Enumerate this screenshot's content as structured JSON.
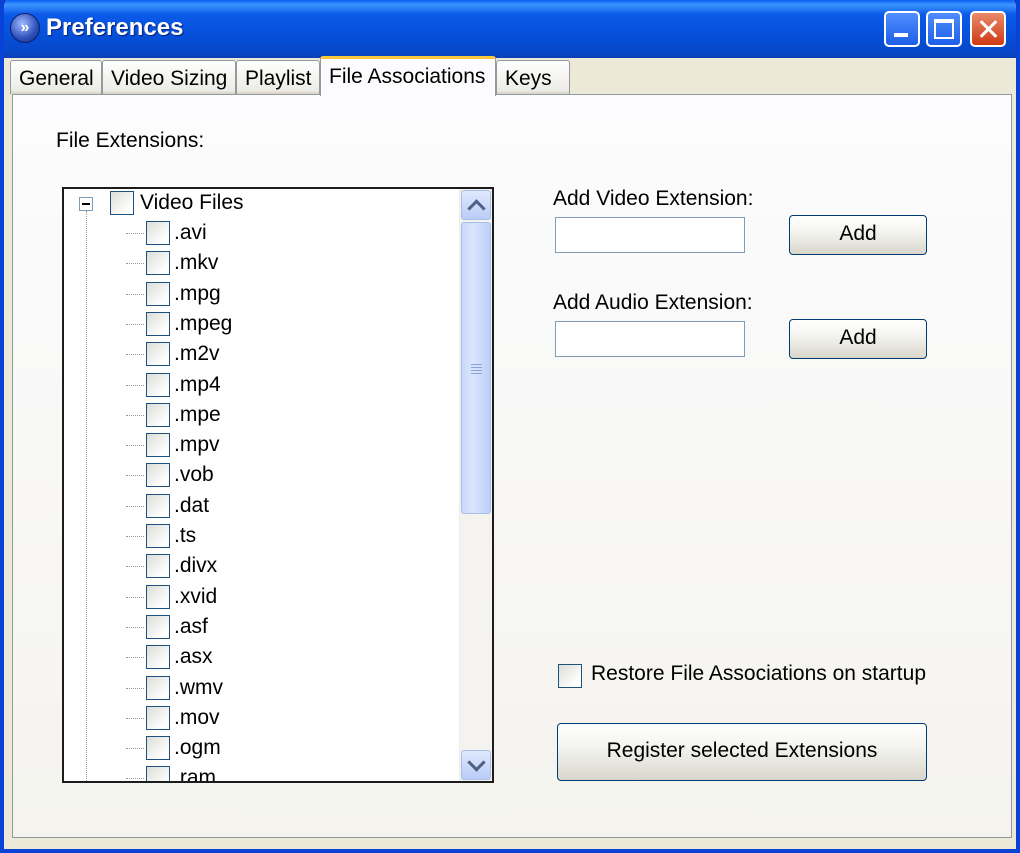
{
  "window": {
    "title": "Preferences"
  },
  "tabs": [
    {
      "label": "General"
    },
    {
      "label": "Video Sizing"
    },
    {
      "label": "Playlist"
    },
    {
      "label": "File Associations"
    },
    {
      "label": "Keys"
    }
  ],
  "active_tab": "File Associations",
  "file_extensions": {
    "label": "File Extensions:",
    "root": {
      "label": "Video Files",
      "checked": false,
      "expanded": true
    },
    "items": [
      ".avi",
      ".mkv",
      ".mpg",
      ".mpeg",
      ".m2v",
      ".mp4",
      ".mpe",
      ".mpv",
      ".vob",
      ".dat",
      ".ts",
      ".divx",
      ".xvid",
      ".asf",
      ".asx",
      ".wmv",
      ".mov",
      ".ogm",
      ".ram"
    ]
  },
  "add_video": {
    "label": "Add Video Extension:",
    "value": "",
    "button_label": "Add"
  },
  "add_audio": {
    "label": "Add Audio Extension:",
    "value": "",
    "button_label": "Add"
  },
  "restore": {
    "label": "Restore File Associations on startup",
    "checked": false
  },
  "register_button": {
    "label": "Register selected Extensions"
  }
}
